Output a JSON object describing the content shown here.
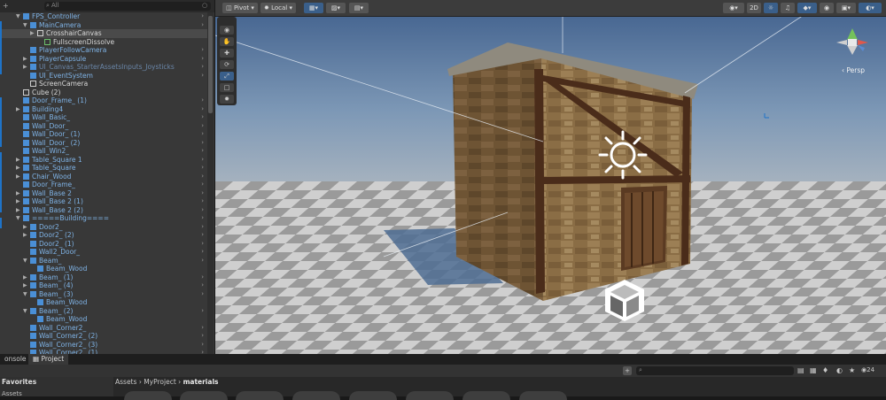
{
  "hierarchy": {
    "search_placeholder": "All",
    "rows": [
      {
        "label": "FPS_Controller",
        "indent": 1,
        "arrow": "down",
        "color": "blue",
        "icon": "prefab",
        "more": true
      },
      {
        "label": "MainCamera",
        "indent": 2,
        "arrow": "down",
        "color": "blue",
        "icon": "prefab",
        "more": true
      },
      {
        "label": "CrosshairCanvas",
        "indent": 3,
        "arrow": "right",
        "color": "white",
        "icon": "gameobject",
        "selected": true
      },
      {
        "label": "FullscreenDissolve",
        "indent": 4,
        "arrow": "",
        "color": "white",
        "icon": "gameobject-green"
      },
      {
        "label": "PlayerFollowCamera",
        "indent": 2,
        "arrow": "",
        "color": "blue",
        "icon": "prefab",
        "more": true
      },
      {
        "label": "PlayerCapsule",
        "indent": 2,
        "arrow": "right",
        "color": "blue",
        "icon": "prefab",
        "more": true
      },
      {
        "label": "UI_Canvas_StarterAssetsInputs_Joysticks",
        "indent": 2,
        "arrow": "right",
        "color": "dim",
        "icon": "prefab",
        "more": true
      },
      {
        "label": "UI_EventSystem",
        "indent": 2,
        "arrow": "",
        "color": "blue",
        "icon": "prefab",
        "more": true
      },
      {
        "label": "ScreenCamera",
        "indent": 2,
        "arrow": "",
        "color": "white",
        "icon": "gameobject"
      },
      {
        "label": "Cube (2)",
        "indent": 1,
        "arrow": "",
        "color": "white",
        "icon": "gameobject"
      },
      {
        "label": "Door_Frame_ (1)",
        "indent": 1,
        "arrow": "",
        "color": "blue",
        "icon": "prefab",
        "more": true
      },
      {
        "label": "Building4",
        "indent": 1,
        "arrow": "right",
        "color": "blue",
        "icon": "prefab",
        "more": true
      },
      {
        "label": "Wall_Basic_",
        "indent": 1,
        "arrow": "",
        "color": "blue",
        "icon": "prefab",
        "more": true
      },
      {
        "label": "Wall_Door_",
        "indent": 1,
        "arrow": "",
        "color": "blue",
        "icon": "prefab",
        "more": true
      },
      {
        "label": "Wall_Door_ (1)",
        "indent": 1,
        "arrow": "",
        "color": "blue",
        "icon": "prefab",
        "more": true
      },
      {
        "label": "Wall_Door_ (2)",
        "indent": 1,
        "arrow": "",
        "color": "blue",
        "icon": "prefab",
        "more": true
      },
      {
        "label": "Wall_Win2_",
        "indent": 1,
        "arrow": "",
        "color": "blue",
        "icon": "prefab",
        "more": true
      },
      {
        "label": "Table_Square 1",
        "indent": 1,
        "arrow": "right",
        "color": "blue",
        "icon": "prefab",
        "more": true
      },
      {
        "label": "Table_Square",
        "indent": 1,
        "arrow": "right",
        "color": "blue",
        "icon": "prefab",
        "more": true
      },
      {
        "label": "Chair_Wood",
        "indent": 1,
        "arrow": "right",
        "color": "blue",
        "icon": "prefab",
        "more": true
      },
      {
        "label": "Door_Frame_",
        "indent": 1,
        "arrow": "",
        "color": "blue",
        "icon": "prefab",
        "more": true
      },
      {
        "label": "Wall_Base 2",
        "indent": 1,
        "arrow": "right",
        "color": "blue",
        "icon": "prefab",
        "more": true
      },
      {
        "label": "Wall_Base 2 (1)",
        "indent": 1,
        "arrow": "right",
        "color": "blue",
        "icon": "prefab",
        "more": true
      },
      {
        "label": "Wall_Base 2 (2)",
        "indent": 1,
        "arrow": "right",
        "color": "blue",
        "icon": "prefab",
        "more": true
      },
      {
        "label": "=====Building====",
        "indent": 1,
        "arrow": "down",
        "color": "blue",
        "icon": "prefab",
        "more": true
      },
      {
        "label": "Door2_",
        "indent": 2,
        "arrow": "right",
        "color": "blue",
        "icon": "prefab",
        "more": true
      },
      {
        "label": "Door2_ (2)",
        "indent": 2,
        "arrow": "right",
        "color": "blue",
        "icon": "prefab",
        "more": true
      },
      {
        "label": "Door2_ (1)",
        "indent": 2,
        "arrow": "",
        "color": "blue",
        "icon": "prefab",
        "more": true
      },
      {
        "label": "Wall2_Door_",
        "indent": 2,
        "arrow": "",
        "color": "blue",
        "icon": "prefab",
        "more": true
      },
      {
        "label": "Beam_",
        "indent": 2,
        "arrow": "down",
        "color": "blue",
        "icon": "prefab",
        "more": true
      },
      {
        "label": "Beam_Wood",
        "indent": 3,
        "arrow": "",
        "color": "blue",
        "icon": "prefab"
      },
      {
        "label": "Beam_ (1)",
        "indent": 2,
        "arrow": "right",
        "color": "blue",
        "icon": "prefab",
        "more": true
      },
      {
        "label": "Beam_ (4)",
        "indent": 2,
        "arrow": "right",
        "color": "blue",
        "icon": "prefab",
        "more": true
      },
      {
        "label": "Beam_ (3)",
        "indent": 2,
        "arrow": "down",
        "color": "blue",
        "icon": "prefab",
        "more": true
      },
      {
        "label": "Beam_Wood",
        "indent": 3,
        "arrow": "",
        "color": "blue",
        "icon": "prefab"
      },
      {
        "label": "Beam_ (2)",
        "indent": 2,
        "arrow": "down",
        "color": "blue",
        "icon": "prefab",
        "more": true
      },
      {
        "label": "Beam_Wood",
        "indent": 3,
        "arrow": "",
        "color": "blue",
        "icon": "prefab"
      },
      {
        "label": "Wall_Corner2_",
        "indent": 2,
        "arrow": "",
        "color": "blue",
        "icon": "prefab",
        "more": true
      },
      {
        "label": "Wall_Corner2_ (2)",
        "indent": 2,
        "arrow": "",
        "color": "blue",
        "icon": "prefab",
        "more": true
      },
      {
        "label": "Wall_Corner2_ (3)",
        "indent": 2,
        "arrow": "",
        "color": "blue",
        "icon": "prefab",
        "more": true
      },
      {
        "label": "Wall_Corner2_ (1)",
        "indent": 2,
        "arrow": "",
        "color": "blue",
        "icon": "prefab",
        "more": true
      }
    ]
  },
  "scene_toolbar": {
    "pivot_label": "Pivot",
    "local_label": "Local",
    "mode_2d_label": "2D"
  },
  "scene_view": {
    "projection_label": "‹ Persp"
  },
  "tool_icons": [
    "view-tool-icon",
    "hand-tool-icon",
    "move-tool-icon",
    "rotate-tool-icon",
    "scale-tool-icon",
    "rect-tool-icon",
    "transform-tool-icon"
  ],
  "bottom_panel": {
    "tabs": [
      "onsole",
      "Project"
    ],
    "breadcrumb": [
      "Assets",
      "MyProject",
      "materials"
    ],
    "favorites_label": "Favorites",
    "assets_label": "Assets",
    "hidden_count": "24"
  },
  "colors": {
    "accent": "#3a79bb",
    "prefab_blue": "#7fb3e6",
    "panel": "#383838"
  }
}
